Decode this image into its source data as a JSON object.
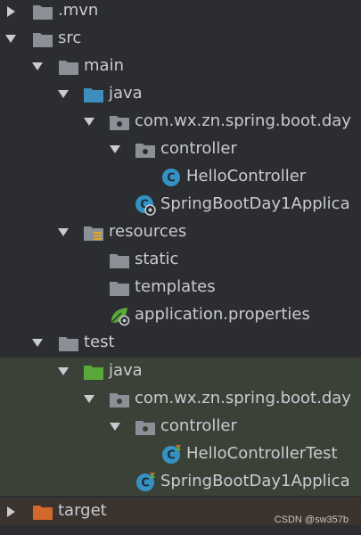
{
  "tree": {
    "mvn_label": ".mvn",
    "src_label": "src",
    "main_label": "main",
    "main_java_label": "java",
    "main_pkg_label": "com.wx.zn.spring.boot.day",
    "main_controller_label": "controller",
    "hello_controller_label": "HelloController",
    "main_app_label": "SpringBootDay1Applica",
    "resources_label": "resources",
    "static_label": "static",
    "templates_label": "templates",
    "app_props_label": "application.properties",
    "test_label": "test",
    "test_java_label": "java",
    "test_pkg_label": "com.wx.zn.spring.boot.day",
    "test_controller_label": "controller",
    "hello_controller_test_label": "HelloControllerTest",
    "test_app_label": "SpringBootDay1Applica",
    "target_label": "target"
  },
  "watermark": "CSDN @sw357b",
  "colors": {
    "background": "#2b2d30",
    "folder": "#8b8f96",
    "source_folder": "#3d8dbf",
    "test_folder": "#5aa83a",
    "excluded_folder": "#d4672a",
    "class_icon": "#3592c4",
    "test_row_bg": "#3a4237",
    "target_row_bg": "#3a332e"
  },
  "icons": {
    "folder": "folder-icon",
    "source_root": "source-folder-icon",
    "test_root": "test-folder-icon",
    "resources_root": "resources-folder-icon",
    "package": "package-icon",
    "class": "class-icon",
    "spring_boot_class": "spring-boot-app-icon",
    "spring_properties": "spring-leaf-icon",
    "excluded_folder": "excluded-folder-icon"
  }
}
